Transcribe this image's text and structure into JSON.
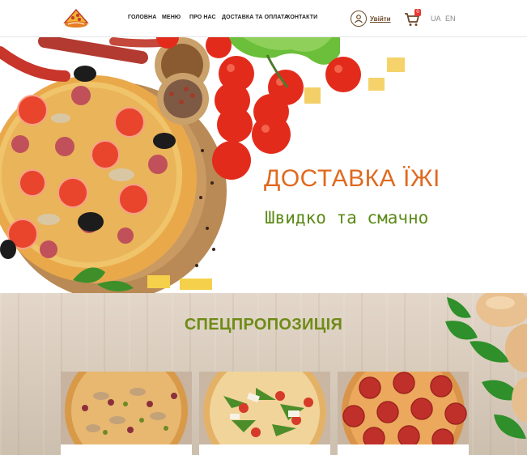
{
  "header": {
    "logo_alt": "pizza-logo",
    "nav": [
      {
        "label": "ГОЛОВНА"
      },
      {
        "label": "МЕНЮ"
      },
      {
        "label": "ПРО НАС"
      },
      {
        "label": "ДОСТАВКА ТА ОПЛАТА"
      },
      {
        "label": "КОНТАКТИ"
      }
    ],
    "login_label": "Увійти",
    "cart_count": "0",
    "languages": [
      "UA",
      "EN"
    ]
  },
  "hero": {
    "title": "ДОСТАВКА ЇЖІ",
    "subtitle": "Швидко та смачно"
  },
  "specials": {
    "title": "СПЕЦПРОПОЗИЦІЯ",
    "cards": [
      {
        "icon": "pizza-mushroom-image"
      },
      {
        "icon": "pizza-arugula-image"
      },
      {
        "icon": "pizza-pepperoni-image"
      }
    ]
  },
  "colors": {
    "accent_orange": "#e06a1e",
    "accent_green": "#5d8a18",
    "brown": "#6b4a2a"
  }
}
